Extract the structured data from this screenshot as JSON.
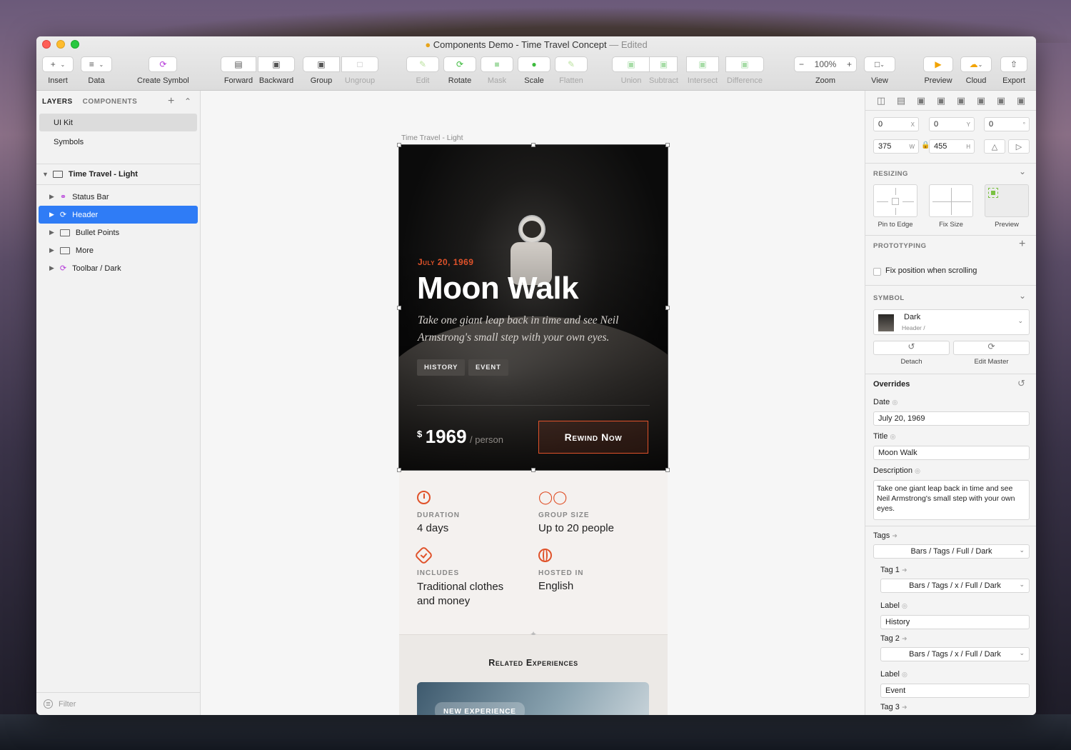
{
  "window": {
    "title": "Components Demo - Time Travel Concept",
    "edited": "— Edited"
  },
  "toolbar": {
    "insert": "Insert",
    "data": "Data",
    "create_symbol": "Create Symbol",
    "forward": "Forward",
    "backward": "Backward",
    "group": "Group",
    "ungroup": "Ungroup",
    "edit": "Edit",
    "rotate": "Rotate",
    "mask": "Mask",
    "scale": "Scale",
    "flatten": "Flatten",
    "union": "Union",
    "subtract": "Subtract",
    "intersect": "Intersect",
    "difference": "Difference",
    "zoom_value": "100%",
    "zoom": "Zoom",
    "view": "View",
    "preview": "Preview",
    "cloud": "Cloud",
    "export": "Export"
  },
  "sidebar": {
    "tab_layers": "LAYERS",
    "tab_components": "COMPONENTS",
    "pages": [
      "UI Kit",
      "Symbols"
    ],
    "artboard": "Time Travel - Light",
    "layers": [
      "Status Bar",
      "Header",
      "Bullet Points",
      "More",
      "Toolbar / Dark"
    ],
    "filter_placeholder": "Filter"
  },
  "canvas": {
    "artboard_label": "Time Travel - Light",
    "date": "July 20, 1969",
    "title": "Moon Walk",
    "description": "Take one giant leap back in time and see Neil Armstrong's small step with your own eyes.",
    "tags": [
      "History",
      "Event"
    ],
    "price_currency": "$",
    "price": "1969",
    "price_unit": "/ person",
    "cta": "Rewind Now",
    "bullets": [
      {
        "label": "DURATION",
        "value": "4 days"
      },
      {
        "label": "GROUP SIZE",
        "value": "Up to 20 people"
      },
      {
        "label": "INCLUDES",
        "value": "Traditional clothes and money"
      },
      {
        "label": "HOSTED IN",
        "value": "English"
      }
    ],
    "related_title": "Related Experiences",
    "new_badge": "NEW EXPERIENCE"
  },
  "inspector": {
    "x": "0",
    "y": "0",
    "rotation": "0",
    "w": "375",
    "h": "455",
    "x_lbl": "X",
    "y_lbl": "Y",
    "w_lbl": "W",
    "h_lbl": "H",
    "deg": "°",
    "resizing": "RESIZING",
    "pin_to_edge": "Pin to Edge",
    "fix_size": "Fix Size",
    "preview": "Preview",
    "prototyping": "PROTOTYPING",
    "fix_position": "Fix position when scrolling",
    "symbol": "SYMBOL",
    "symbol_name": "Dark",
    "symbol_path": "Header /",
    "detach": "Detach",
    "edit_master": "Edit Master",
    "overrides": "Overrides",
    "date_lbl": "Date",
    "date_val": "July 20, 1969",
    "title_lbl": "Title",
    "title_val": "Moon Walk",
    "desc_lbl": "Description",
    "desc_val": "Take one giant leap back in time and see Neil Armstrong's small step with your own eyes.",
    "tags_lbl": "Tags",
    "tags_val": "Bars / Tags / Full / Dark",
    "tag1_lbl": "Tag 1",
    "tag1_val": "Bars / Tags / x / Full / Dark",
    "label_lbl": "Label",
    "label1_val": "History",
    "tag2_lbl": "Tag 2",
    "tag2_val": "Bars / Tags / x / Full / Dark",
    "label2_val": "Event",
    "tag3_lbl": "Tag 3"
  },
  "colors": {
    "accent": "#e0522a",
    "selection": "#2f7cf6",
    "symbol": "#b437d9"
  }
}
